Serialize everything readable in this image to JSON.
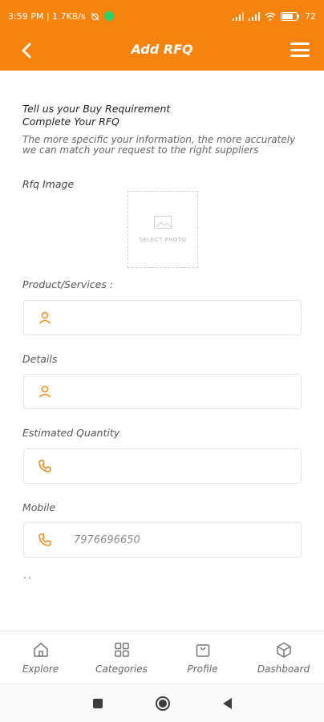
{
  "status": {
    "time_speed": "3:59 PM | 1.7KB/s",
    "battery": "72"
  },
  "header": {
    "title": "Add RFQ"
  },
  "intro": {
    "line1": "Tell us your Buy Requirement",
    "line2": "Complete Your RFQ",
    "description": "The more specific your information, the more accurately we can match your request to the right suppliers"
  },
  "rfq_image": {
    "label": "Rfq Image",
    "caption": "SELECT PHOTO"
  },
  "form": {
    "product": {
      "label": "Product/Services :",
      "value": ""
    },
    "details": {
      "label": "Details",
      "value": ""
    },
    "quantity": {
      "label": "Estimated Quantity",
      "value": ""
    },
    "mobile": {
      "label": "Mobile",
      "value": "7976696650"
    },
    "trailing": ".."
  },
  "bottom_nav": [
    {
      "label": "Explore",
      "icon": "home-icon"
    },
    {
      "label": "Categories",
      "icon": "grid-icon"
    },
    {
      "label": "Profile",
      "icon": "bag-icon"
    },
    {
      "label": "Dashboard",
      "icon": "cube-icon"
    }
  ],
  "colors": {
    "brand": "#f7830f",
    "icon_accent": "#f08a1c"
  }
}
